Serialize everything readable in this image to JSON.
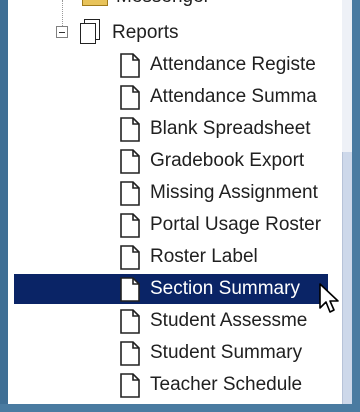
{
  "tree": {
    "top_partial_label": "Messenger",
    "folder": {
      "toggle": "−",
      "label": "Reports"
    },
    "items": [
      {
        "label": "Attendance Registe",
        "selected": false
      },
      {
        "label": "Attendance Summa",
        "selected": false
      },
      {
        "label": "Blank Spreadsheet",
        "selected": false
      },
      {
        "label": "Gradebook Export",
        "selected": false
      },
      {
        "label": "Missing Assignment",
        "selected": false
      },
      {
        "label": "Portal Usage Roster",
        "selected": false
      },
      {
        "label": "Roster Label",
        "selected": false
      },
      {
        "label": "Section Summary",
        "selected": true
      },
      {
        "label": "Student Assessme",
        "selected": false
      },
      {
        "label": "Student Summary",
        "selected": false
      },
      {
        "label": "Teacher Schedule",
        "selected": false
      }
    ]
  },
  "colors": {
    "selection_background": "#0a2466",
    "frame": "#4a7ba1",
    "scrollbar_thumb": "#cdd8ea"
  }
}
